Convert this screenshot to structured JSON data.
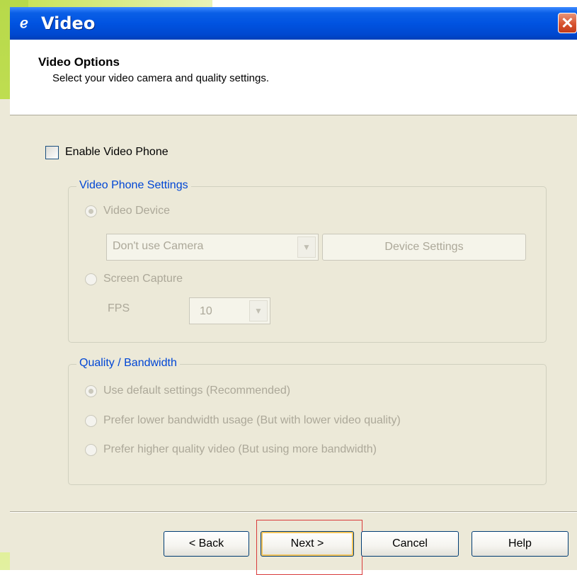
{
  "window": {
    "title": "Video",
    "close_glyph": "✕"
  },
  "header": {
    "title": "Video Options",
    "subtitle": "Select your video camera and quality settings."
  },
  "enable_video_phone": {
    "label": "Enable Video Phone",
    "checked": false
  },
  "video_phone_settings": {
    "legend": "Video Phone Settings",
    "video_device_label": "Video Device",
    "camera_select_value": "Don't use Camera",
    "device_settings_label": "Device Settings",
    "screen_capture_label": "Screen Capture",
    "fps_label": "FPS",
    "fps_value": "10"
  },
  "quality": {
    "legend": "Quality / Bandwidth",
    "options": [
      "Use default settings (Recommended)",
      "Prefer lower bandwidth usage (But with lower video quality)",
      "Prefer higher quality video (But using more bandwidth)"
    ]
  },
  "buttons": {
    "back": "< Back",
    "next": "Next >",
    "cancel": "Cancel",
    "help": "Help"
  },
  "colors": {
    "titlebar": "#0053e1",
    "legend_text": "#0046d5",
    "disabled_text": "#aca899",
    "focus_highlight": "#d93a3a"
  }
}
